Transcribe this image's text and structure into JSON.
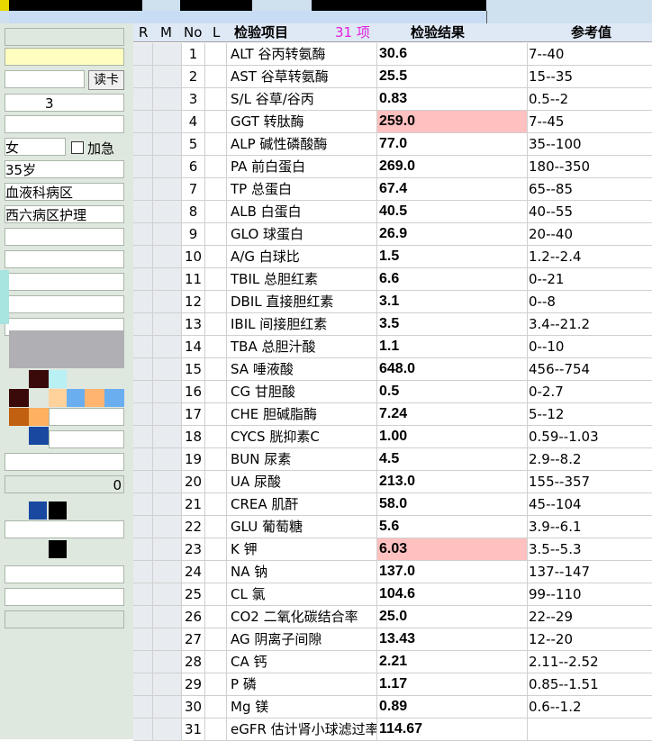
{
  "left_panel": {
    "read_card_button": "读卡",
    "id_fragment": "3",
    "gender": "女",
    "urgent_label": "加急",
    "age": "35岁",
    "department": "血液科病区",
    "ward": "西六病区护理",
    "count_value": "0"
  },
  "table": {
    "headers": {
      "r": "R",
      "m": "M",
      "no": "No",
      "l": "L",
      "item": "检验项目",
      "count": "31 项",
      "result": "检验结果",
      "reference": "参考值"
    },
    "rows": [
      {
        "no": "1",
        "name": "ALT 谷丙转氨酶",
        "value": "30.6",
        "ref": "7--40",
        "high": false
      },
      {
        "no": "2",
        "name": "AST 谷草转氨酶",
        "value": "25.5",
        "ref": "15--35",
        "high": false
      },
      {
        "no": "3",
        "name": "S/L 谷草/谷丙",
        "value": "0.83",
        "ref": "0.5--2",
        "high": false
      },
      {
        "no": "4",
        "name": "GGT 转肽酶",
        "value": "259.0",
        "ref": "7--45",
        "high": true
      },
      {
        "no": "5",
        "name": "ALP 碱性磷酸酶",
        "value": "77.0",
        "ref": "35--100",
        "high": false
      },
      {
        "no": "6",
        "name": "PA 前白蛋白",
        "value": "269.0",
        "ref": "180--350",
        "high": false
      },
      {
        "no": "7",
        "name": "TP 总蛋白",
        "value": "67.4",
        "ref": "65--85",
        "high": false
      },
      {
        "no": "8",
        "name": "ALB 白蛋白",
        "value": "40.5",
        "ref": "40--55",
        "high": false
      },
      {
        "no": "9",
        "name": "GLO 球蛋白",
        "value": "26.9",
        "ref": "20--40",
        "high": false
      },
      {
        "no": "10",
        "name": "A/G 白球比",
        "value": "1.5",
        "ref": "1.2--2.4",
        "high": false
      },
      {
        "no": "11",
        "name": "TBIL 总胆红素",
        "value": "6.6",
        "ref": "0--21",
        "high": false
      },
      {
        "no": "12",
        "name": "DBIL 直接胆红素",
        "value": "3.1",
        "ref": "0--8",
        "high": false
      },
      {
        "no": "13",
        "name": "IBIL 间接胆红素",
        "value": "3.5",
        "ref": "3.4--21.2",
        "high": false
      },
      {
        "no": "14",
        "name": "TBA 总胆汁酸",
        "value": "1.1",
        "ref": "0--10",
        "high": false
      },
      {
        "no": "15",
        "name": "SA 唾液酸",
        "value": "648.0",
        "ref": "456--754",
        "high": false
      },
      {
        "no": "16",
        "name": "CG 甘胆酸",
        "value": "0.5",
        "ref": "0-2.7",
        "high": false
      },
      {
        "no": "17",
        "name": "CHE 胆碱脂酶",
        "value": "7.24",
        "ref": "5--12",
        "high": false
      },
      {
        "no": "18",
        "name": "CYCS 胱抑素C",
        "value": "1.00",
        "ref": "0.59--1.03",
        "high": false
      },
      {
        "no": "19",
        "name": "BUN 尿素",
        "value": "4.5",
        "ref": "2.9--8.2",
        "high": false
      },
      {
        "no": "20",
        "name": "UA 尿酸",
        "value": "213.0",
        "ref": "155--357",
        "high": false
      },
      {
        "no": "21",
        "name": "CREA 肌酐",
        "value": "58.0",
        "ref": "45--104",
        "high": false
      },
      {
        "no": "22",
        "name": "GLU 葡萄糖",
        "value": "5.6",
        "ref": "3.9--6.1",
        "high": false
      },
      {
        "no": "23",
        "name": "K 钾",
        "value": "6.03",
        "ref": "3.5--5.3",
        "high": true
      },
      {
        "no": "24",
        "name": "NA 钠",
        "value": "137.0",
        "ref": "137--147",
        "high": false
      },
      {
        "no": "25",
        "name": "CL 氯",
        "value": "104.6",
        "ref": "99--110",
        "high": false
      },
      {
        "no": "26",
        "name": "CO2 二氧化碳结合率",
        "value": "25.0",
        "ref": "22--29",
        "high": false
      },
      {
        "no": "27",
        "name": "AG 阴离子间隙",
        "value": "13.43",
        "ref": "12--20",
        "high": false
      },
      {
        "no": "28",
        "name": "CA 钙",
        "value": "2.21",
        "ref": "2.11--2.52",
        "high": false
      },
      {
        "no": "29",
        "name": "P 磷",
        "value": "1.17",
        "ref": "0.85--1.51",
        "high": false
      },
      {
        "no": "30",
        "name": "Mg 镁",
        "value": "0.89",
        "ref": "0.6--1.2",
        "high": false
      },
      {
        "no": "31",
        "name": "eGFR 估计肾小球滤过率",
        "value": "114.67",
        "ref": "",
        "high": false
      }
    ]
  },
  "colors": {
    "highlight": "#ffc0c0",
    "header_bg": "#dfe8f5",
    "left_bg": "#dfe8df",
    "count_color": "#e020e0"
  }
}
